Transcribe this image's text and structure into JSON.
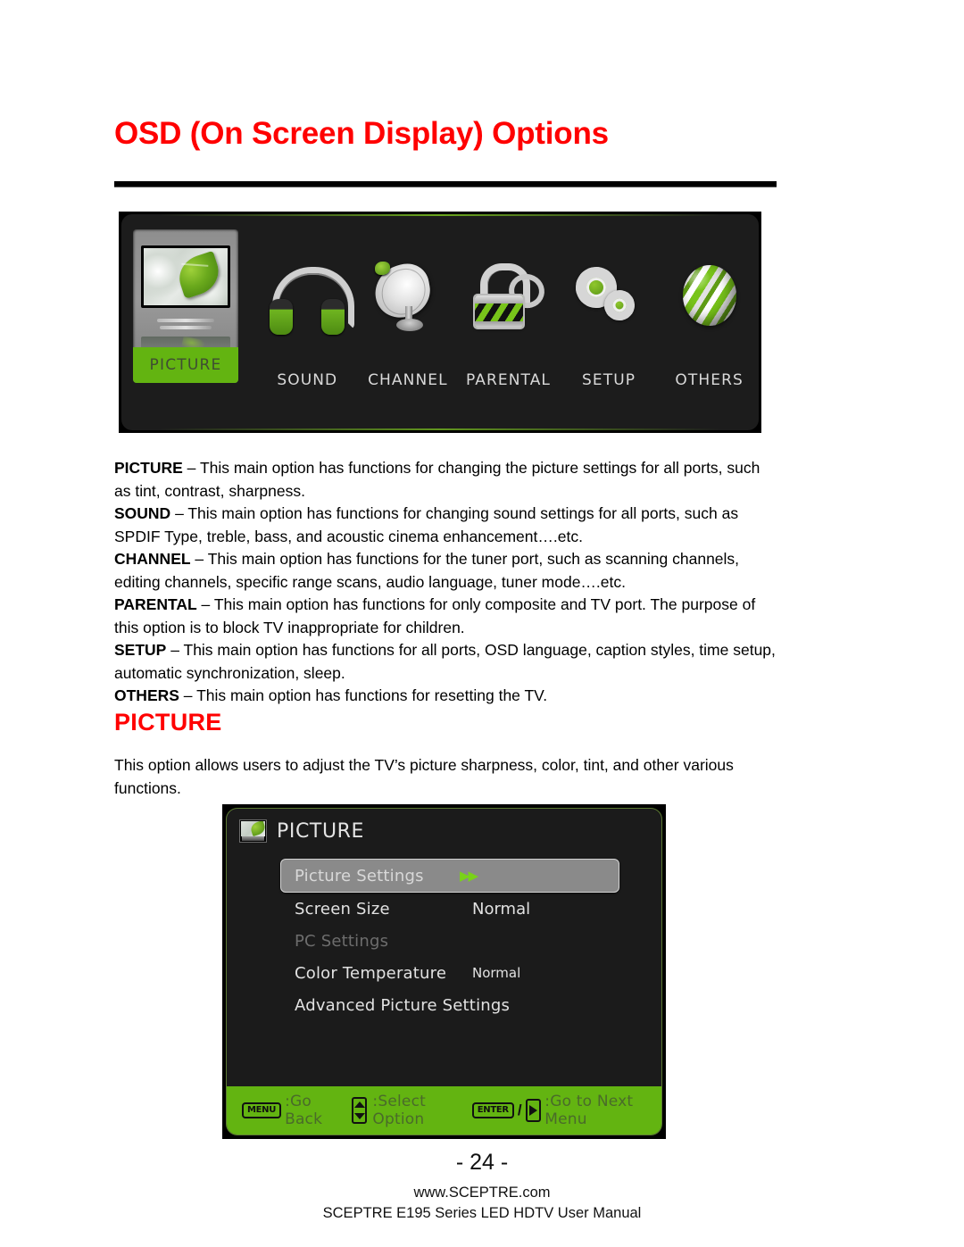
{
  "page": {
    "title": "OSD (On Screen Display) Options",
    "title_color": "#ff0000",
    "number": "24",
    "page_number_display": "- 24 -",
    "website": "www.SCEPTRE.com",
    "manual_line": "SCEPTRE E195 Series LED HDTV User Manual"
  },
  "osd_menu_bar": {
    "selected": "PICTURE",
    "items": [
      {
        "label": "PICTURE",
        "icon": "tv-picture-icon",
        "selected": true
      },
      {
        "label": "SOUND",
        "icon": "headphones-icon",
        "selected": false
      },
      {
        "label": "CHANNEL",
        "icon": "satellite-dish-icon",
        "selected": false
      },
      {
        "label": "PARENTAL",
        "icon": "padlock-icon",
        "selected": false
      },
      {
        "label": "SETUP",
        "icon": "gears-icon",
        "selected": false
      },
      {
        "label": "OTHERS",
        "icon": "globe-icon",
        "selected": false
      }
    ],
    "highlight_color": "#63b411",
    "background_color": "#1c1c1c"
  },
  "descriptions": [
    {
      "term": "PICTURE",
      "dash": " – ",
      "text": "This main option has functions for changing the picture settings for all ports, such as tint, contrast, sharpness."
    },
    {
      "term": "SOUND",
      "dash": " – ",
      "text": "This main option has functions for changing sound settings for all ports, such as SPDIF Type, treble, bass, and acoustic cinema enhancement….etc."
    },
    {
      "term": "CHANNEL",
      "dash": " – ",
      "text": "This main option has functions for the tuner port, such as scanning channels, editing channels, specific range scans, audio language, tuner mode….etc."
    },
    {
      "term": "PARENTAL",
      "dash": " – ",
      "text": "This main option has functions for only composite and TV port.  The purpose of this option is to block TV inappropriate for children."
    },
    {
      "term": "SETUP",
      "dash": " – ",
      "text": "This main option has functions for all ports, OSD language, caption styles, time setup, automatic synchronization, sleep."
    },
    {
      "term": "OTHERS",
      "dash": " – ",
      "text": "This main option has functions for resetting the TV."
    }
  ],
  "section": {
    "heading": "PICTURE",
    "heading_color": "#ff0000",
    "paragraph": "This option allows users to adjust the TV’s picture sharpness, color, tint, and other various functions."
  },
  "picture_osd": {
    "title": "PICTURE",
    "rows": [
      {
        "label": "Picture Settings",
        "value": "▶▶",
        "state": "selected"
      },
      {
        "label": "Screen Size",
        "value": "Normal",
        "state": "normal"
      },
      {
        "label": "PC Settings",
        "value": "",
        "state": "disabled"
      },
      {
        "label": "Color Temperature",
        "value": "Normal",
        "state": "normal-small"
      },
      {
        "label": "Advanced Picture Settings",
        "value": "",
        "state": "normal"
      }
    ],
    "footer": {
      "menu_key": "MENU",
      "menu_text": ":Go Back",
      "updown_text": ":Select Option",
      "enter_key": "ENTER",
      "slash": "/",
      "next_text": ":Go to Next Menu"
    },
    "footer_color": "#63b411"
  }
}
